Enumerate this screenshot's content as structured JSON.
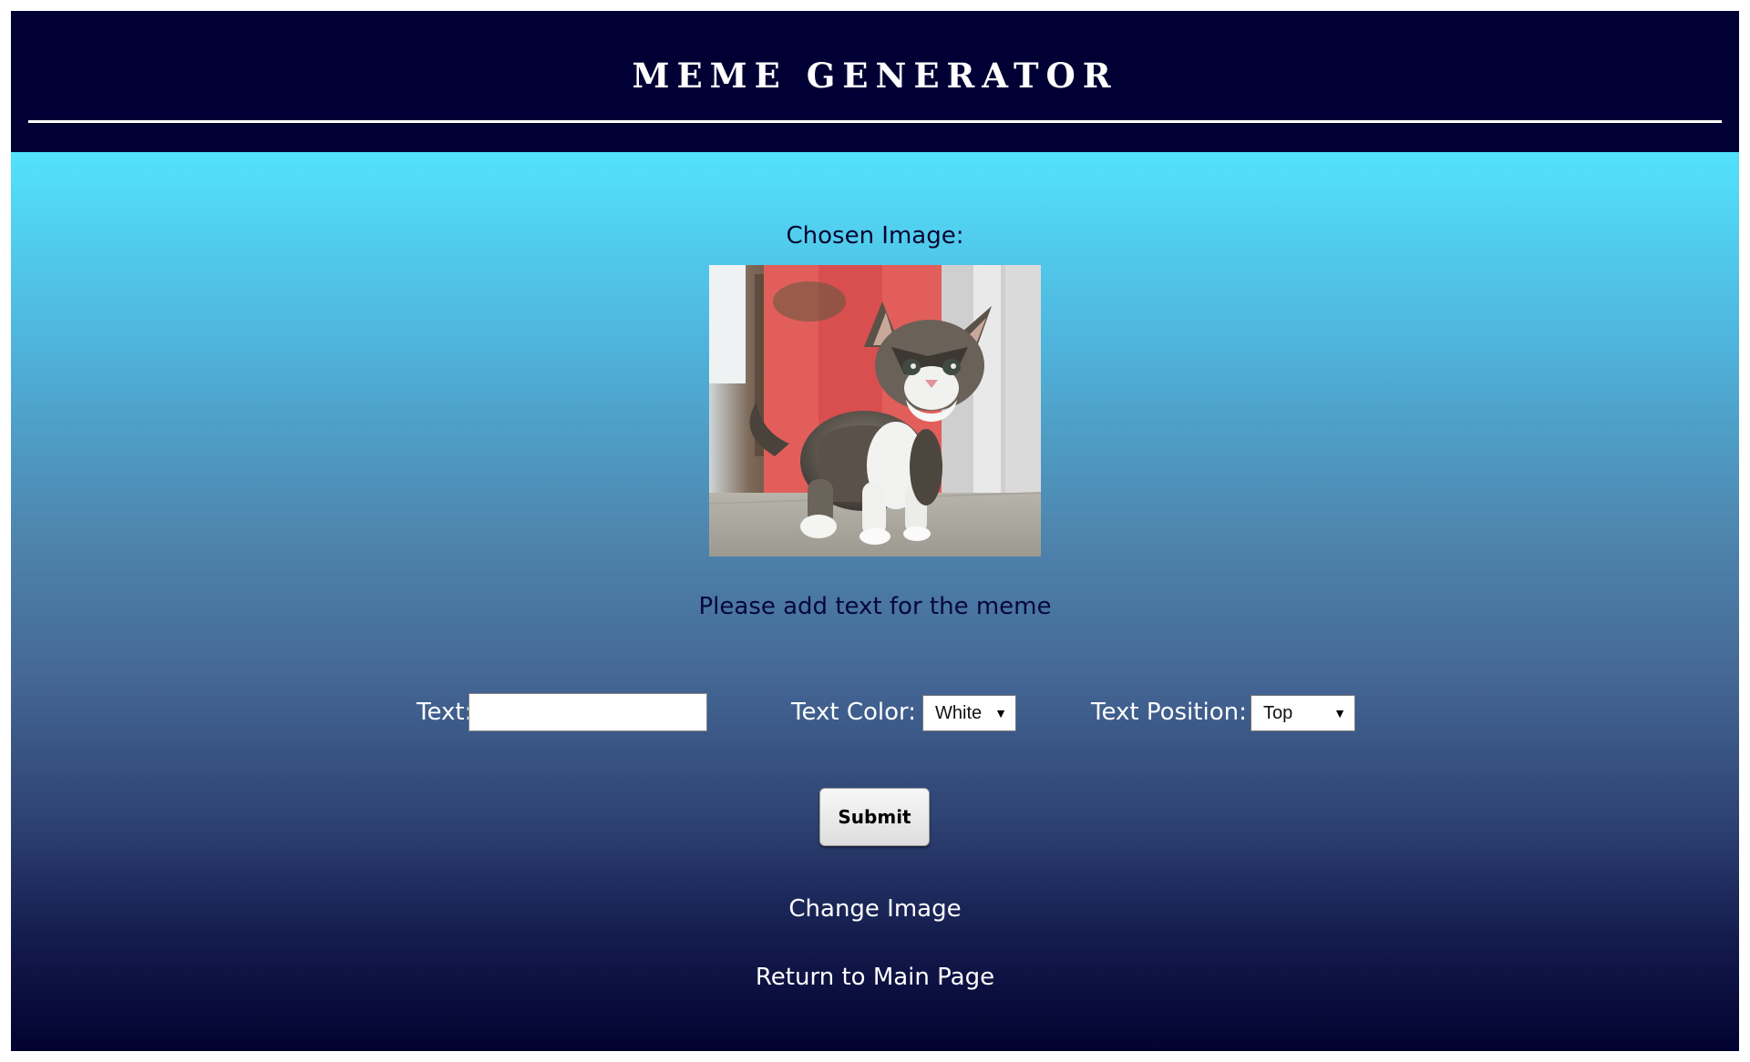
{
  "header": {
    "title": "MEME GENERATOR"
  },
  "main": {
    "chosen_label": "Chosen Image:",
    "image_icon": "kitten-photo",
    "instruction": "Please add text for the meme"
  },
  "form": {
    "text_label": "Text:",
    "text_value": "",
    "color_label": "Text Color:",
    "color_selected": "White",
    "position_label": "Text Position:",
    "position_selected": "Top",
    "dropdown_icon": "triangle-down-icon",
    "submit_label": "Submit"
  },
  "links": {
    "change_image": "Change Image",
    "return_main": "Return to Main Page"
  },
  "colors": {
    "header_bg": "#000034",
    "gradient_top": "#52e2fd",
    "gradient_bottom": "#02022f",
    "dark_text": "#06062f",
    "light_text": "#ffffff"
  }
}
